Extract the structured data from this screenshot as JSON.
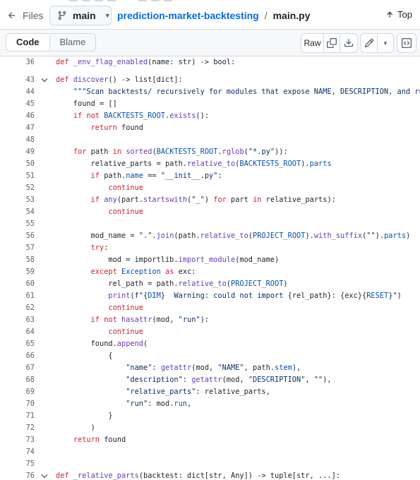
{
  "header": {
    "files_label": "Files",
    "branch": "main",
    "repo": "prediction-market-backtesting",
    "separator": "/",
    "file": "main.py",
    "top_label": "Top"
  },
  "toolbar": {
    "code_tab": "Code",
    "blame_tab": "Blame",
    "raw_label": "Raw"
  },
  "icons": {
    "back": "arrow-left-icon",
    "branch": "git-branch-icon",
    "top": "arrow-up-icon",
    "copy": "copy-icon",
    "download": "download-icon",
    "edit": "pencil-icon",
    "more": "triangle-down-icon",
    "symbols": "code-square-icon",
    "fold": "chevron-down-icon"
  },
  "colors": {
    "keyword": "#cf222e",
    "function": "#6639ba",
    "constant": "#0550ae",
    "string": "#0a3069",
    "link": "#0969da",
    "line_number": "#59636e"
  },
  "code_lines": [
    {
      "n": "36",
      "fold": false,
      "tokens": [
        {
          "t": "def ",
          "c": "k"
        },
        {
          "t": "_env_flag_enabled",
          "c": "f"
        },
        {
          "t": "(name: str) -> bool:",
          "c": ""
        }
      ]
    },
    {
      "n": "",
      "fold": false,
      "tokens": []
    },
    {
      "n": "43",
      "fold": true,
      "tokens": [
        {
          "t": "def ",
          "c": "k"
        },
        {
          "t": "discover",
          "c": "f"
        },
        {
          "t": "() -> list[dict]:",
          "c": ""
        }
      ]
    },
    {
      "n": "44",
      "fold": false,
      "tokens": [
        {
          "t": "    \"\"\"Scan backtests/ recursively for modules that expose NAME, DESCRIPTION, and run().\"\"\"",
          "c": "s"
        }
      ]
    },
    {
      "n": "45",
      "fold": false,
      "tokens": [
        {
          "t": "    found = []",
          "c": ""
        }
      ]
    },
    {
      "n": "46",
      "fold": false,
      "tokens": [
        {
          "t": "    ",
          "c": ""
        },
        {
          "t": "if not ",
          "c": "k"
        },
        {
          "t": "BACKTESTS_ROOT",
          "c": "c"
        },
        {
          "t": ".",
          "c": ""
        },
        {
          "t": "exists",
          "c": "f"
        },
        {
          "t": "():",
          "c": ""
        }
      ]
    },
    {
      "n": "47",
      "fold": false,
      "tokens": [
        {
          "t": "        ",
          "c": ""
        },
        {
          "t": "return",
          "c": "k"
        },
        {
          "t": " found",
          "c": ""
        }
      ]
    },
    {
      "n": "48",
      "fold": false,
      "tokens": []
    },
    {
      "n": "49",
      "fold": false,
      "tokens": [
        {
          "t": "    ",
          "c": ""
        },
        {
          "t": "for",
          "c": "k"
        },
        {
          "t": " path ",
          "c": ""
        },
        {
          "t": "in",
          "c": "k"
        },
        {
          "t": " ",
          "c": ""
        },
        {
          "t": "sorted",
          "c": "f"
        },
        {
          "t": "(",
          "c": ""
        },
        {
          "t": "BACKTESTS_ROOT",
          "c": "c"
        },
        {
          "t": ".",
          "c": ""
        },
        {
          "t": "rglob",
          "c": "f"
        },
        {
          "t": "(",
          "c": ""
        },
        {
          "t": "\"*.py\"",
          "c": "s"
        },
        {
          "t": ")):",
          "c": ""
        }
      ]
    },
    {
      "n": "50",
      "fold": false,
      "tokens": [
        {
          "t": "        relative_parts = path.",
          "c": ""
        },
        {
          "t": "relative_to",
          "c": "f"
        },
        {
          "t": "(",
          "c": ""
        },
        {
          "t": "BACKTESTS_ROOT",
          "c": "c"
        },
        {
          "t": ").",
          "c": ""
        },
        {
          "t": "parts",
          "c": "c"
        }
      ]
    },
    {
      "n": "51",
      "fold": false,
      "tokens": [
        {
          "t": "        ",
          "c": ""
        },
        {
          "t": "if",
          "c": "k"
        },
        {
          "t": " path.",
          "c": ""
        },
        {
          "t": "name",
          "c": "c"
        },
        {
          "t": " == ",
          "c": ""
        },
        {
          "t": "\"__init__.py\"",
          "c": "s"
        },
        {
          "t": ":",
          "c": ""
        }
      ]
    },
    {
      "n": "52",
      "fold": false,
      "tokens": [
        {
          "t": "            ",
          "c": ""
        },
        {
          "t": "continue",
          "c": "k"
        }
      ]
    },
    {
      "n": "53",
      "fold": false,
      "tokens": [
        {
          "t": "        ",
          "c": ""
        },
        {
          "t": "if",
          "c": "k"
        },
        {
          "t": " ",
          "c": ""
        },
        {
          "t": "any",
          "c": "f"
        },
        {
          "t": "(part.",
          "c": ""
        },
        {
          "t": "startswith",
          "c": "f"
        },
        {
          "t": "(",
          "c": ""
        },
        {
          "t": "\"_\"",
          "c": "s"
        },
        {
          "t": ") ",
          "c": ""
        },
        {
          "t": "for",
          "c": "k"
        },
        {
          "t": " part ",
          "c": ""
        },
        {
          "t": "in",
          "c": "k"
        },
        {
          "t": " relative_parts):",
          "c": ""
        }
      ]
    },
    {
      "n": "54",
      "fold": false,
      "tokens": [
        {
          "t": "            ",
          "c": ""
        },
        {
          "t": "continue",
          "c": "k"
        }
      ]
    },
    {
      "n": "55",
      "fold": false,
      "tokens": []
    },
    {
      "n": "56",
      "fold": false,
      "tokens": [
        {
          "t": "        mod_name = ",
          "c": ""
        },
        {
          "t": "\".\"",
          "c": "s"
        },
        {
          "t": ".",
          "c": ""
        },
        {
          "t": "join",
          "c": "f"
        },
        {
          "t": "(path.",
          "c": ""
        },
        {
          "t": "relative_to",
          "c": "f"
        },
        {
          "t": "(",
          "c": ""
        },
        {
          "t": "PROJECT_ROOT",
          "c": "c"
        },
        {
          "t": ").",
          "c": ""
        },
        {
          "t": "with_suffix",
          "c": "f"
        },
        {
          "t": "(",
          "c": ""
        },
        {
          "t": "\"\"",
          "c": "s"
        },
        {
          "t": ").",
          "c": ""
        },
        {
          "t": "parts",
          "c": "c"
        },
        {
          "t": ")",
          "c": ""
        }
      ]
    },
    {
      "n": "57",
      "fold": false,
      "tokens": [
        {
          "t": "        ",
          "c": ""
        },
        {
          "t": "try",
          "c": "k"
        },
        {
          "t": ":",
          "c": ""
        }
      ]
    },
    {
      "n": "58",
      "fold": false,
      "tokens": [
        {
          "t": "            mod = importlib.",
          "c": ""
        },
        {
          "t": "import_module",
          "c": "f"
        },
        {
          "t": "(mod_name)",
          "c": ""
        }
      ]
    },
    {
      "n": "59",
      "fold": false,
      "tokens": [
        {
          "t": "        ",
          "c": ""
        },
        {
          "t": "except",
          "c": "k"
        },
        {
          "t": " ",
          "c": ""
        },
        {
          "t": "Exception",
          "c": "c"
        },
        {
          "t": " ",
          "c": ""
        },
        {
          "t": "as",
          "c": "k"
        },
        {
          "t": " exc:",
          "c": ""
        }
      ]
    },
    {
      "n": "60",
      "fold": false,
      "tokens": [
        {
          "t": "            rel_path = path.",
          "c": ""
        },
        {
          "t": "relative_to",
          "c": "f"
        },
        {
          "t": "(",
          "c": ""
        },
        {
          "t": "PROJECT_ROOT",
          "c": "c"
        },
        {
          "t": ")",
          "c": ""
        }
      ]
    },
    {
      "n": "61",
      "fold": false,
      "tokens": [
        {
          "t": "            ",
          "c": ""
        },
        {
          "t": "print",
          "c": "f"
        },
        {
          "t": "(",
          "c": ""
        },
        {
          "t": "f\"",
          "c": "s"
        },
        {
          "t": "{",
          "c": ""
        },
        {
          "t": "DIM",
          "c": "c"
        },
        {
          "t": "}",
          "c": ""
        },
        {
          "t": "  Warning: could not import ",
          "c": "s"
        },
        {
          "t": "{rel_path}",
          "c": ""
        },
        {
          "t": ": ",
          "c": "s"
        },
        {
          "t": "{exc}{",
          "c": ""
        },
        {
          "t": "RESET",
          "c": "c"
        },
        {
          "t": "}",
          "c": ""
        },
        {
          "t": "\"",
          "c": "s"
        },
        {
          "t": ")",
          "c": ""
        }
      ]
    },
    {
      "n": "62",
      "fold": false,
      "tokens": [
        {
          "t": "            ",
          "c": ""
        },
        {
          "t": "continue",
          "c": "k"
        }
      ]
    },
    {
      "n": "63",
      "fold": false,
      "tokens": [
        {
          "t": "        ",
          "c": ""
        },
        {
          "t": "if not ",
          "c": "k"
        },
        {
          "t": "hasattr",
          "c": "f"
        },
        {
          "t": "(mod, ",
          "c": ""
        },
        {
          "t": "\"run\"",
          "c": "s"
        },
        {
          "t": "):",
          "c": ""
        }
      ]
    },
    {
      "n": "64",
      "fold": false,
      "tokens": [
        {
          "t": "            ",
          "c": ""
        },
        {
          "t": "continue",
          "c": "k"
        }
      ]
    },
    {
      "n": "65",
      "fold": false,
      "tokens": [
        {
          "t": "        found.",
          "c": ""
        },
        {
          "t": "append",
          "c": "f"
        },
        {
          "t": "(",
          "c": ""
        }
      ]
    },
    {
      "n": "66",
      "fold": false,
      "tokens": [
        {
          "t": "            {",
          "c": ""
        }
      ]
    },
    {
      "n": "67",
      "fold": false,
      "tokens": [
        {
          "t": "                ",
          "c": ""
        },
        {
          "t": "\"name\"",
          "c": "s"
        },
        {
          "t": ": ",
          "c": ""
        },
        {
          "t": "getattr",
          "c": "f"
        },
        {
          "t": "(mod, ",
          "c": ""
        },
        {
          "t": "\"NAME\"",
          "c": "s"
        },
        {
          "t": ", path.",
          "c": ""
        },
        {
          "t": "stem",
          "c": "c"
        },
        {
          "t": "),",
          "c": ""
        }
      ]
    },
    {
      "n": "68",
      "fold": false,
      "tokens": [
        {
          "t": "                ",
          "c": ""
        },
        {
          "t": "\"description\"",
          "c": "s"
        },
        {
          "t": ": ",
          "c": ""
        },
        {
          "t": "getattr",
          "c": "f"
        },
        {
          "t": "(mod, ",
          "c": ""
        },
        {
          "t": "\"DESCRIPTION\"",
          "c": "s"
        },
        {
          "t": ", ",
          "c": ""
        },
        {
          "t": "\"\"",
          "c": "s"
        },
        {
          "t": "),",
          "c": ""
        }
      ]
    },
    {
      "n": "69",
      "fold": false,
      "tokens": [
        {
          "t": "                ",
          "c": ""
        },
        {
          "t": "\"relative_parts\"",
          "c": "s"
        },
        {
          "t": ": relative_parts,",
          "c": ""
        }
      ]
    },
    {
      "n": "70",
      "fold": false,
      "tokens": [
        {
          "t": "                ",
          "c": ""
        },
        {
          "t": "\"run\"",
          "c": "s"
        },
        {
          "t": ": mod.",
          "c": ""
        },
        {
          "t": "run",
          "c": "c"
        },
        {
          "t": ",",
          "c": ""
        }
      ]
    },
    {
      "n": "71",
      "fold": false,
      "tokens": [
        {
          "t": "            }",
          "c": ""
        }
      ]
    },
    {
      "n": "72",
      "fold": false,
      "tokens": [
        {
          "t": "        )",
          "c": ""
        }
      ]
    },
    {
      "n": "73",
      "fold": false,
      "tokens": [
        {
          "t": "    ",
          "c": ""
        },
        {
          "t": "return",
          "c": "k"
        },
        {
          "t": " found",
          "c": ""
        }
      ]
    },
    {
      "n": "74",
      "fold": false,
      "tokens": []
    },
    {
      "n": "75",
      "fold": false,
      "tokens": []
    },
    {
      "n": "76",
      "fold": true,
      "tokens": [
        {
          "t": "def ",
          "c": "k"
        },
        {
          "t": "_relative_parts",
          "c": "f"
        },
        {
          "t": "(backtest: dict[str, Any]) -> tuple[str, ...]:",
          "c": ""
        }
      ]
    }
  ]
}
